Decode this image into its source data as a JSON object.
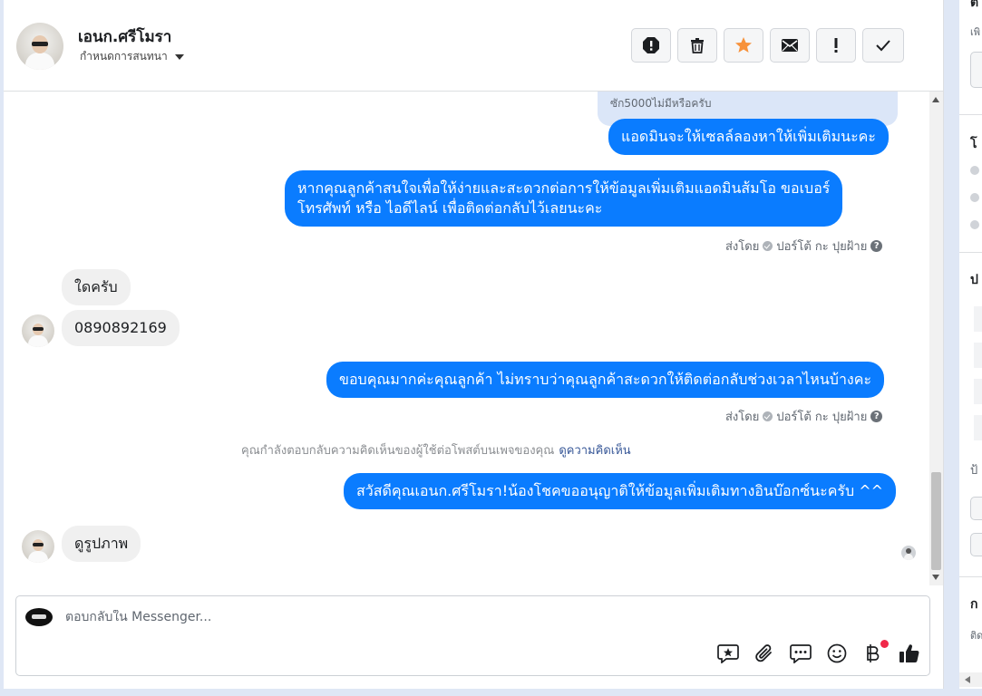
{
  "header": {
    "contact_name": "เอนก.ศรีโมรา",
    "subtitle": "กำหนดการสนทนา",
    "actions": [
      {
        "name": "report-spam-icon"
      },
      {
        "name": "trash-icon"
      },
      {
        "name": "star-icon",
        "color": "#f7923b"
      },
      {
        "name": "envelope-icon"
      },
      {
        "name": "exclamation-icon"
      },
      {
        "name": "checkmark-icon"
      }
    ]
  },
  "messages": {
    "quoted_reply": "ซัก5000ไม่มีหรือครับ",
    "m1": "แอดมินจะให้เซลล์ลองหาให้เพิ่มเติมนะคะ",
    "m2_line1": "หากคุณลูกค้าสนใจเพื่อให้ง่ายและสะดวกต่อการให้ข้อมูลเพิ่มเติมแอดมินส้มโอ ขอเบอร์",
    "m2_line2": "โทรศัพท์ หรือ ไอดีไลน์ เพื่อติดต่อกลับไว้เลยนะคะ",
    "sent_by_1": "ส่งโดย",
    "sender_1": "ปอร์โต้ กะ ปุยฝ้าย",
    "in1": "ใดครับ",
    "in2": "0890892169",
    "m3": "ขอบคุณมากค่ะคุณลูกค้า ไม่ทราบว่าคุณลูกค้าสะดวกให้ติดต่อกลับช่วงเวลาไหนบ้างคะ",
    "sent_by_2": "ส่งโดย",
    "sender_2": "ปอร์โต้ กะ ปุยฝ้าย",
    "system_note": "คุณกำลังตอบกลับความคิดเห็นของผู้ใช้ต่อโพสต์บนเพจของคุณ",
    "system_link": "ดูความคิดเห็น",
    "m4": "สวัสดีคุณเอนก.ศรีโมรา!น้องโชคขออนุญาติให้ข้อมูลเพิ่มเติมทางอินบ๊อกซ์นะครับ ^^",
    "in3": "ดูรูปภาพ"
  },
  "composer": {
    "placeholder": "ตอบกลับใน Messenger...",
    "tools": [
      "saved-reply-icon",
      "attachment-icon",
      "quick-reply-icon",
      "emoji-icon",
      "baht-payment-icon",
      "thumbs-up-icon"
    ],
    "accent": "#f02849"
  },
  "colors": {
    "outgoing_bubble": "#0a7cff",
    "incoming_bubble": "#f0f0f0"
  }
}
